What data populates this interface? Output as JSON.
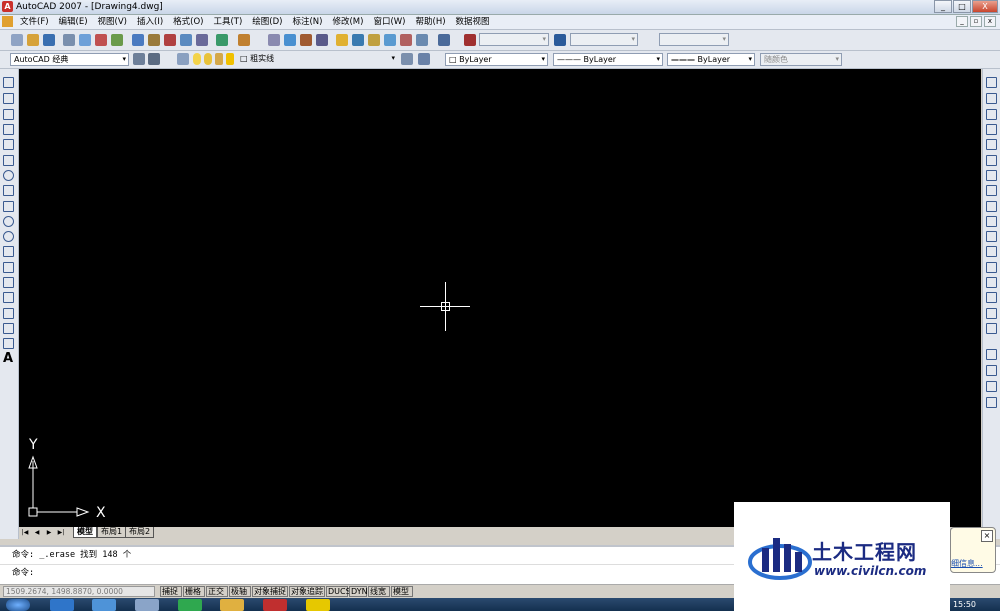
{
  "window": {
    "title": "AutoCAD 2007 - [Drawing4.dwg]",
    "buttons": {
      "minimize": "_",
      "maximize": "□",
      "close": "X"
    }
  },
  "menubar": {
    "items": [
      "文件(F)",
      "编辑(E)",
      "视图(V)",
      "插入(I)",
      "格式(O)",
      "工具(T)",
      "绘图(D)",
      "标注(N)",
      "修改(M)",
      "窗口(W)",
      "帮助(H)",
      "数据视图"
    ],
    "doc_buttons": {
      "minimize": "_",
      "restore": "▫",
      "close": "x"
    }
  },
  "toolbar2": {
    "workspace": "AutoCAD 经典",
    "layer": "粗实线",
    "color": "ByLayer",
    "linetype": "ByLayer",
    "lineweight": "ByLayer",
    "plotstyle": "随颜色"
  },
  "tabs": {
    "items": [
      {
        "label": "模型",
        "active": true
      },
      {
        "label": "布局1",
        "active": false
      },
      {
        "label": "布局2",
        "active": false
      }
    ]
  },
  "ucs": {
    "x_label": "X",
    "y_label": "Y"
  },
  "command": {
    "line1": "命令: _.erase 找到 148 个",
    "line2": "命令:"
  },
  "status": {
    "coords": "1509.2674, 1498.8870, 0.0000",
    "toggles": [
      "捕捉",
      "栅格",
      "正交",
      "极轴",
      "对象捕捉",
      "对象追踪",
      "DUCS",
      "DYN",
      "线宽",
      "模型"
    ]
  },
  "taskbar": {
    "clock": "15:50"
  },
  "popup": {
    "link": "细信息..."
  },
  "watermark": {
    "title": "土木工程网",
    "url": "www.civilcn.com"
  },
  "colors": {
    "canvas": "#000000",
    "crosshair": "#ffffff",
    "watermark": "#1b2b82",
    "taskbar": "#1d3a5c"
  }
}
